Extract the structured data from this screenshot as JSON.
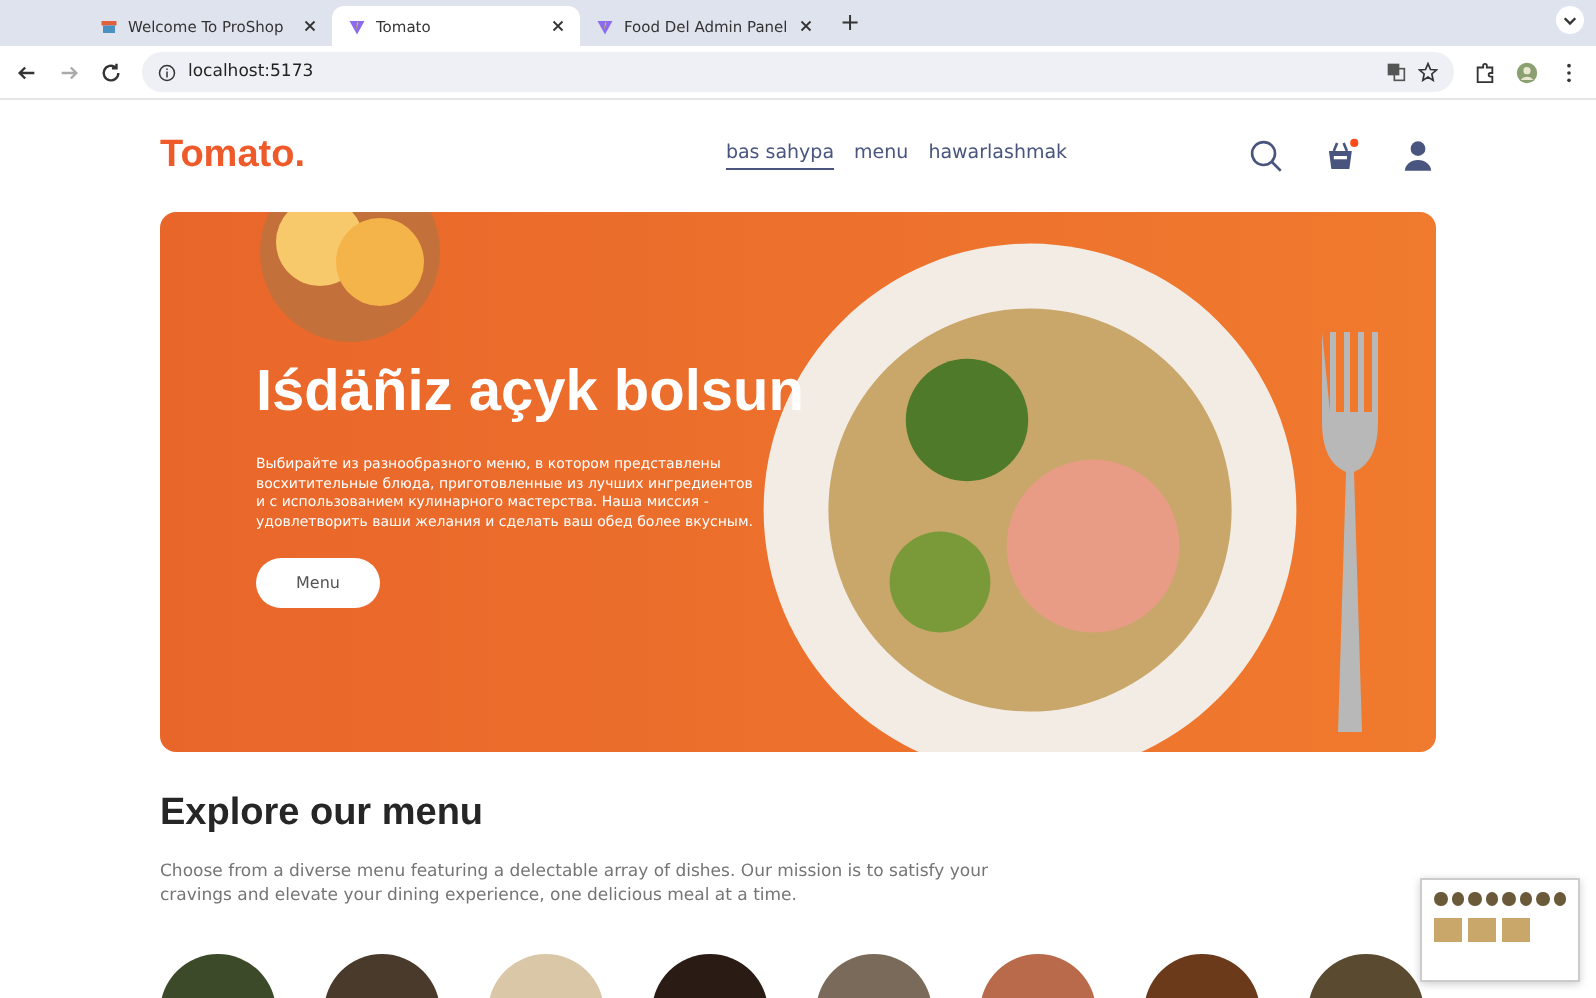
{
  "browser": {
    "tabs": [
      {
        "title": "Welcome To ProShop",
        "kind": "store",
        "selected": false
      },
      {
        "title": "Tomato",
        "kind": "app",
        "selected": true
      },
      {
        "title": "Food Del Admin Panel",
        "kind": "app",
        "selected": false
      }
    ],
    "new_tab": "+",
    "address": "localhost:5173"
  },
  "navbar": {
    "logo": "Tomato.",
    "links": [
      {
        "label": "bas sahypa",
        "selected": true
      },
      {
        "label": "menu",
        "selected": false
      },
      {
        "label": "hawarlashmak",
        "selected": false
      }
    ],
    "cart_has_items": true
  },
  "hero": {
    "title": "Iśdäñiz açyk bolsun",
    "text": "Выбирайте из разнообразного меню, в котором представлены восхитительные блюда, приготовленные из лучших ингредиентов и с использованием кулинарного мастерства. Наша миссия - удовлетворить ваши желания и сделать ваш обед более вкусным.",
    "button": "Menu"
  },
  "explore": {
    "title": "Explore our menu",
    "text": "Choose from a diverse menu featuring a delectable array of dishes. Our mission is to satisfy your cravings and elevate your dining experience, one delicious meal at a time."
  }
}
